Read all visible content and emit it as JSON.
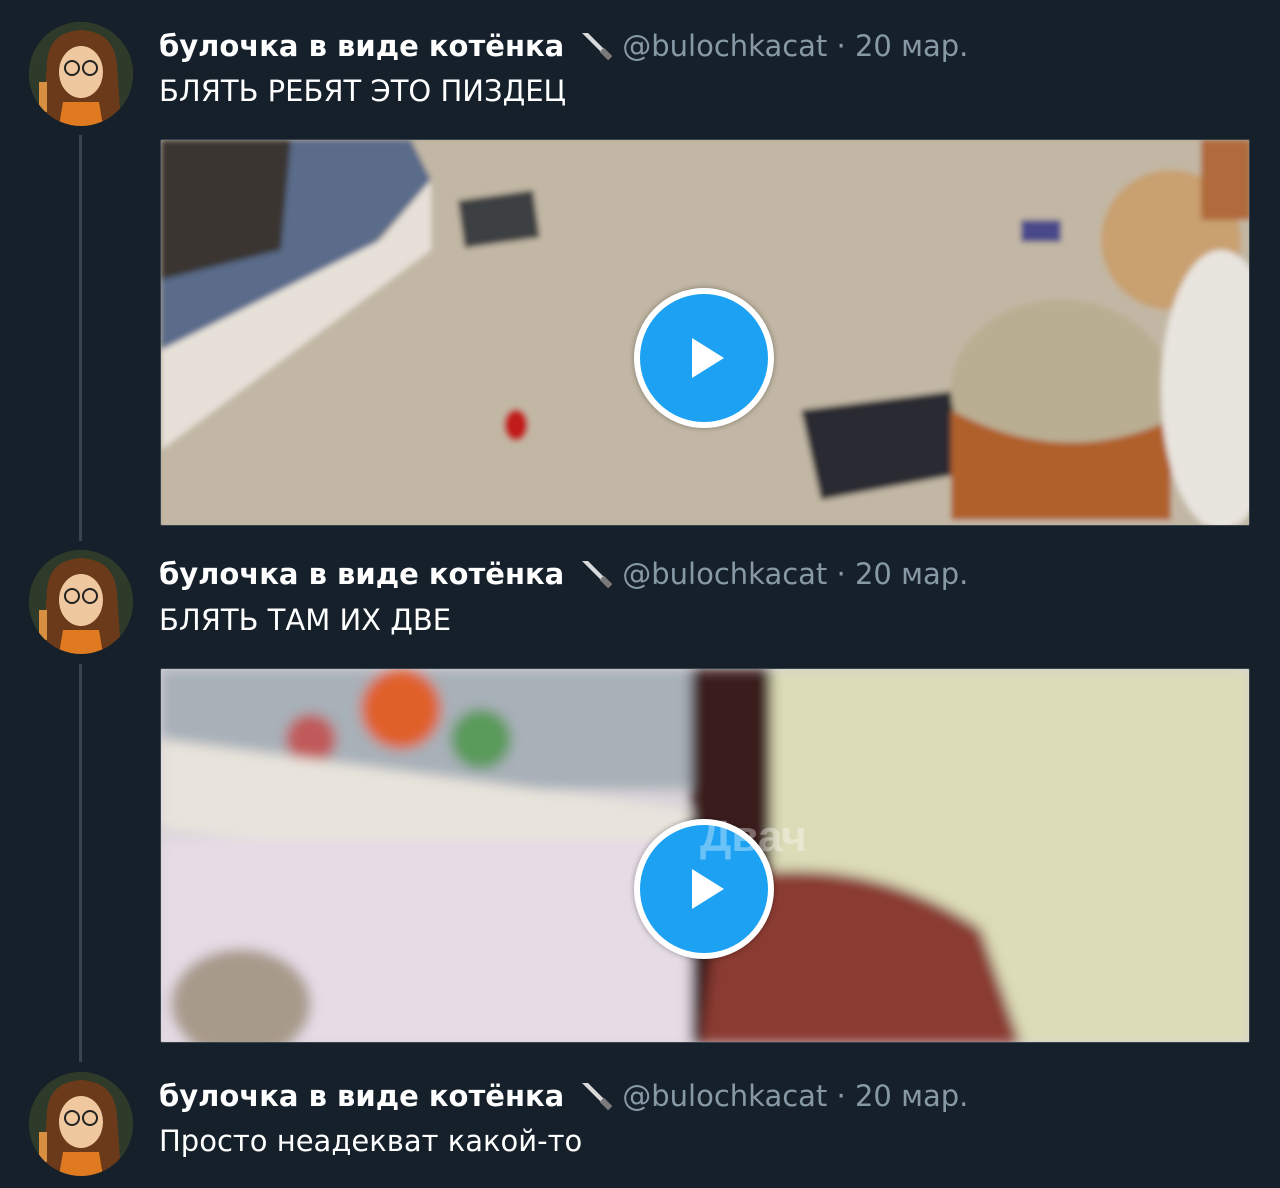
{
  "tweets": [
    {
      "name": "булочка в виде котёнка",
      "handle": "@bulochkacat",
      "date": "20 мар.",
      "text": "БЛЯТЬ РЕБЯТ ЭТО ПИЗДЕЦ",
      "media": "video"
    },
    {
      "name": "булочка в виде котёнка",
      "handle": "@bulochkacat",
      "date": "20 мар.",
      "text": "БЛЯТЬ ТАМ ИХ ДВЕ",
      "media": "video"
    },
    {
      "name": "булочка в виде котёнка",
      "handle": "@bulochkacat",
      "date": "20 мар.",
      "text": "Просто неадекват какой-то",
      "media": null
    }
  ],
  "separator": " · ",
  "watermark": "Двач",
  "icons": {
    "name_emoji": "knife-icon",
    "play": "play-icon"
  },
  "colors": {
    "background": "#15202b",
    "handle_text": "#8899a6",
    "play_button": "#1da1f2",
    "thread_line": "#38444d"
  }
}
